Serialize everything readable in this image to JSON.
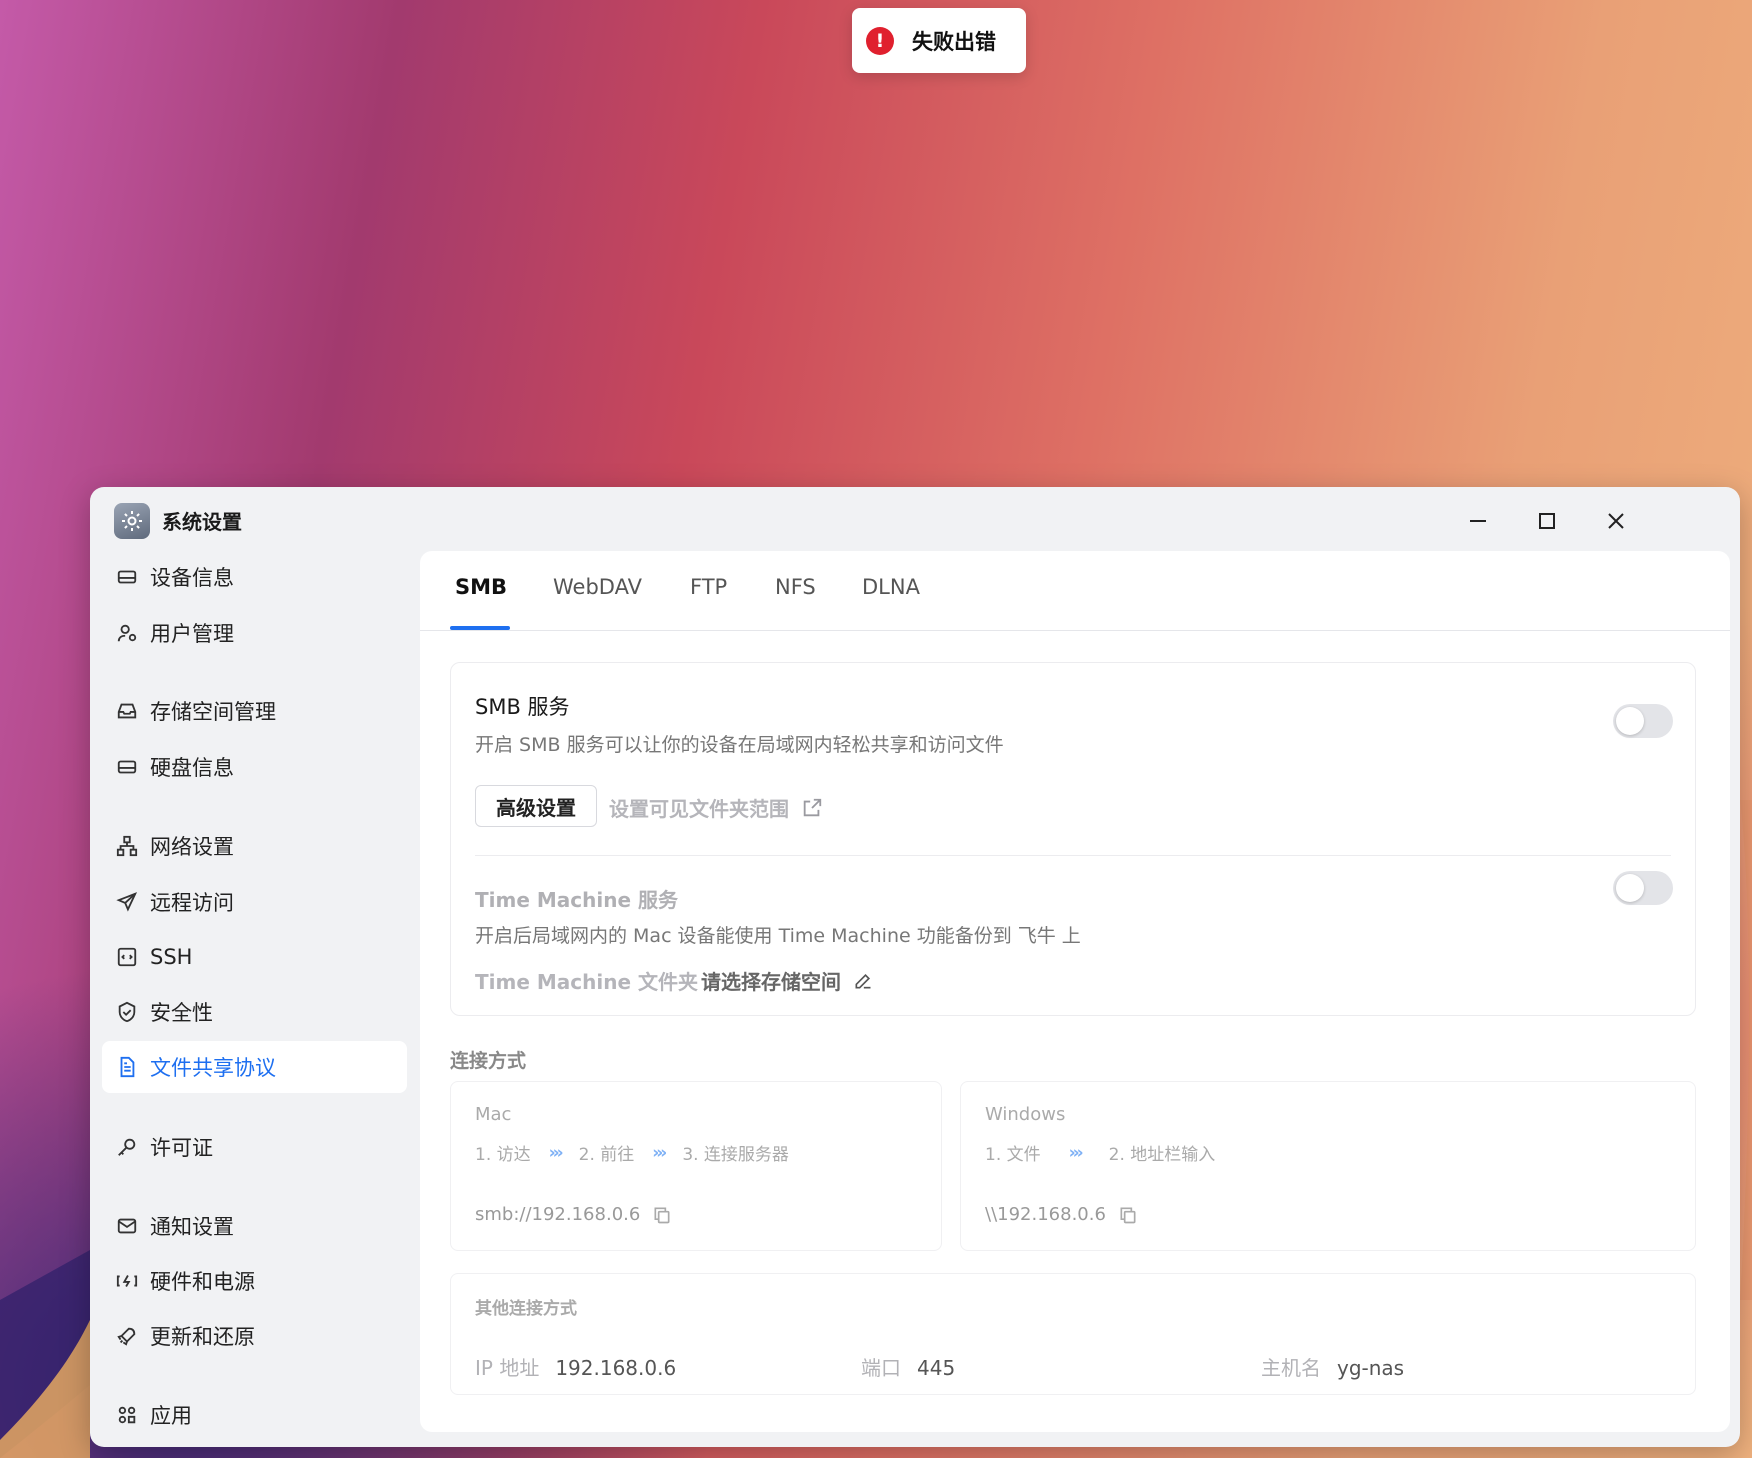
{
  "toast": {
    "message": "失败出错",
    "icon": "error-icon",
    "color": "#e0202e"
  },
  "window": {
    "title": "系统设置",
    "accent": "#1e6ff0"
  },
  "sidebar": {
    "items": [
      {
        "label": "设备信息",
        "icon": "device-icon",
        "active": false
      },
      {
        "label": "用户管理",
        "icon": "user-icon",
        "active": false
      },
      {
        "label": "存储空间管理",
        "icon": "storage-icon",
        "active": false
      },
      {
        "label": "硬盘信息",
        "icon": "disk-icon",
        "active": false
      },
      {
        "label": "网络设置",
        "icon": "network-icon",
        "active": false
      },
      {
        "label": "远程访问",
        "icon": "send-icon",
        "active": false
      },
      {
        "label": "SSH",
        "icon": "terminal-icon",
        "active": false
      },
      {
        "label": "安全性",
        "icon": "shield-icon",
        "active": false
      },
      {
        "label": "文件共享协议",
        "icon": "document-icon",
        "active": true
      },
      {
        "label": "许可证",
        "icon": "key-icon",
        "active": false
      },
      {
        "label": "通知设置",
        "icon": "mail-icon",
        "active": false
      },
      {
        "label": "硬件和电源",
        "icon": "power-icon",
        "active": false
      },
      {
        "label": "更新和还原",
        "icon": "rocket-icon",
        "active": false
      },
      {
        "label": "应用",
        "icon": "apps-icon",
        "active": false
      }
    ]
  },
  "tabs": [
    {
      "label": "SMB",
      "active": true
    },
    {
      "label": "WebDAV",
      "active": false
    },
    {
      "label": "FTP",
      "active": false
    },
    {
      "label": "NFS",
      "active": false
    },
    {
      "label": "DLNA",
      "active": false
    }
  ],
  "smb": {
    "title": "SMB 服务",
    "description": "开启 SMB 服务可以让你的设备在局域网内轻松共享和访问文件",
    "enabled": false,
    "advanced_button": "高级设置",
    "folder_scope_link": "设置可见文件夹范围"
  },
  "time_machine": {
    "title": "Time Machine 服务",
    "description": "开启后局域网内的 Mac 设备能使用 Time Machine 功能备份到 飞牛 上",
    "enabled": false,
    "folder_label": "Time Machine 文件夹",
    "folder_value": "请选择存储空间"
  },
  "connection": {
    "section_title": "连接方式",
    "mac": {
      "label": "Mac",
      "steps": [
        "1. 访达",
        "2. 前往",
        "3. 连接服务器"
      ],
      "address": "smb://192.168.0.6"
    },
    "windows": {
      "label": "Windows",
      "steps": [
        "1. 文件",
        "2. 地址栏输入"
      ],
      "address": "\\\\192.168.0.6"
    },
    "arrows": "›››"
  },
  "other": {
    "title": "其他连接方式",
    "ip_label": "IP 地址",
    "ip_value": "192.168.0.6",
    "port_label": "端口",
    "port_value": "445",
    "host_label": "主机名",
    "host_value": "yg-nas"
  }
}
